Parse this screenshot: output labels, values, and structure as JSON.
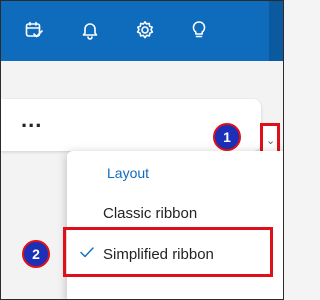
{
  "topbar": {
    "icons": [
      "calendar-check-icon",
      "bell-icon",
      "gear-icon",
      "lightbulb-icon"
    ],
    "accent": "#0f6cbd"
  },
  "ribbon": {
    "more_label": "..."
  },
  "dropdown": {
    "chevron": "⌄"
  },
  "markers": {
    "one": "1",
    "two": "2"
  },
  "menu": {
    "heading": "Layout",
    "items": [
      {
        "label": "Classic ribbon",
        "selected": false
      },
      {
        "label": "Simplified ribbon",
        "selected": true
      }
    ]
  },
  "colors": {
    "highlight": "#e0101a",
    "marker": "#1b2fb8"
  }
}
